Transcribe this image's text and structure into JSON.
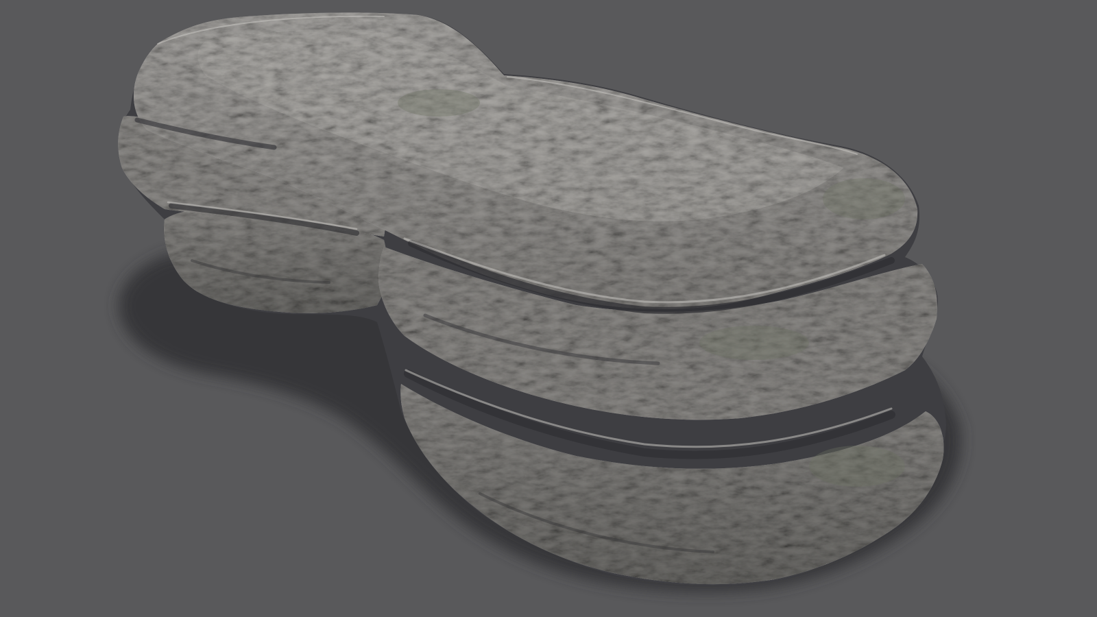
{
  "scene": {
    "subject": "layered-rock",
    "colors": {
      "background": "#59595b",
      "shadow": "#363638",
      "rock_light": "#9c9a97",
      "rock_mid": "#7b7a77",
      "rock_dark": "#3c3c40",
      "moss": "#6e7461"
    }
  }
}
